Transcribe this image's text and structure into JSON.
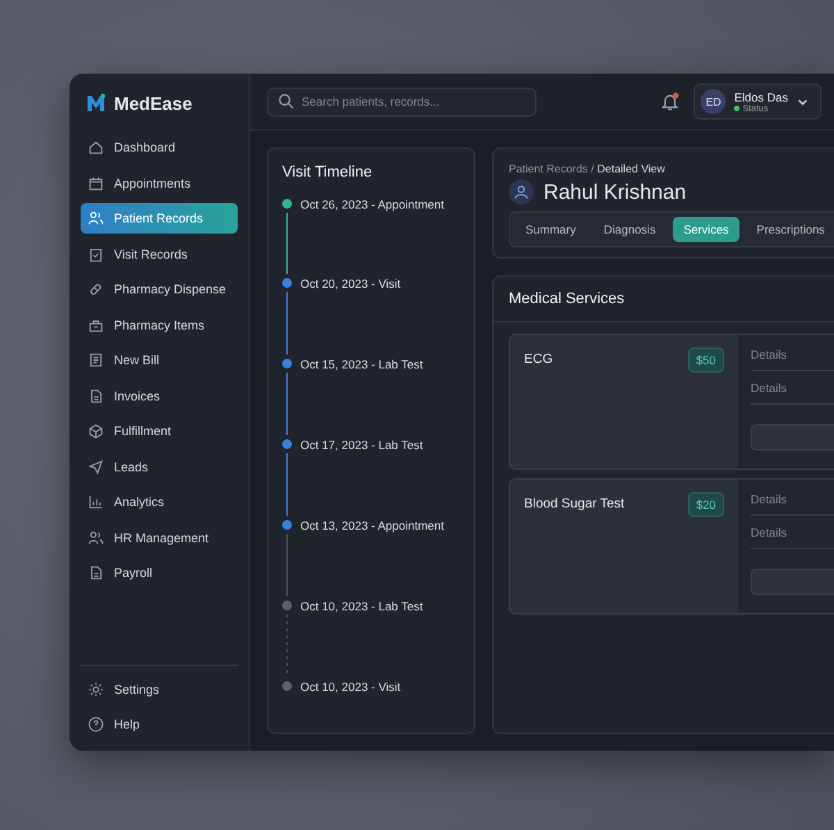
{
  "app": {
    "name": "MedEase"
  },
  "sidebar": {
    "items": [
      {
        "label": "Dashboard",
        "selected": false
      },
      {
        "label": "Appointments",
        "selected": false
      },
      {
        "label": "Patient Records",
        "selected": true
      },
      {
        "label": "Visit Records",
        "selected": false
      },
      {
        "label": "Pharmacy Dispense",
        "selected": false
      },
      {
        "label": "Pharmacy Items",
        "selected": false
      },
      {
        "label": "New Bill",
        "selected": false
      },
      {
        "label": "Invoices",
        "selected": false
      },
      {
        "label": "Fulfillment",
        "selected": false
      },
      {
        "label": "Leads",
        "selected": false
      },
      {
        "label": "Analytics",
        "selected": false
      },
      {
        "label": "HR Management",
        "selected": false
      },
      {
        "label": "Payroll",
        "selected": false
      }
    ],
    "footer_items": [
      {
        "label": "Settings"
      },
      {
        "label": "Help"
      }
    ]
  },
  "header": {
    "search": {
      "placeholder": "Search patients, records..."
    },
    "notifications": {
      "unread": true
    },
    "user": {
      "initials": "ED",
      "name": "Eldos Das",
      "status": "Status",
      "online": true
    }
  },
  "timeline": {
    "title": "Visit Timeline",
    "items": [
      {
        "label": "Oct 26, 2023 - Appointment",
        "color": "#2fb59a",
        "kind": "accent"
      },
      {
        "label": "Oct 20, 2023 - Visit",
        "color": "#3b7fe0",
        "kind": "accent"
      },
      {
        "label": "Oct 15, 2023 - Lab Test",
        "color": "#3b7fe0",
        "kind": "accent"
      },
      {
        "label": "Oct 17, 2023 - Lab Test",
        "color": "#3b7fe0",
        "kind": "accent"
      },
      {
        "label": "Oct 13, 2023 - Appointment",
        "color": "#3b7fe0",
        "kind": "muted"
      },
      {
        "label": "Oct 10, 2023 - Lab Test",
        "color": "#5b606b",
        "kind": "dotted"
      },
      {
        "label": "Oct 10, 2023 - Visit",
        "color": "#5b606b",
        "kind": "last"
      }
    ]
  },
  "patient": {
    "breadcrumb": {
      "parent": "Patient Records",
      "separator": "/",
      "current": "Detailed View"
    },
    "name": "Rahul Krishnan",
    "tabs": [
      {
        "label": "Summary",
        "selected": false
      },
      {
        "label": "Diagnosis",
        "selected": false
      },
      {
        "label": "Services",
        "selected": true
      },
      {
        "label": "Prescriptions",
        "selected": false
      }
    ]
  },
  "services": {
    "title": "Medical Services",
    "items": [
      {
        "name": "ECG",
        "price": "$50",
        "fields": [
          {
            "placeholder": "Details"
          },
          {
            "placeholder": "Details"
          }
        ]
      },
      {
        "name": "Blood Sugar Test",
        "price": "$20",
        "fields": [
          {
            "placeholder": "Details"
          },
          {
            "placeholder": "Details"
          }
        ]
      }
    ]
  }
}
